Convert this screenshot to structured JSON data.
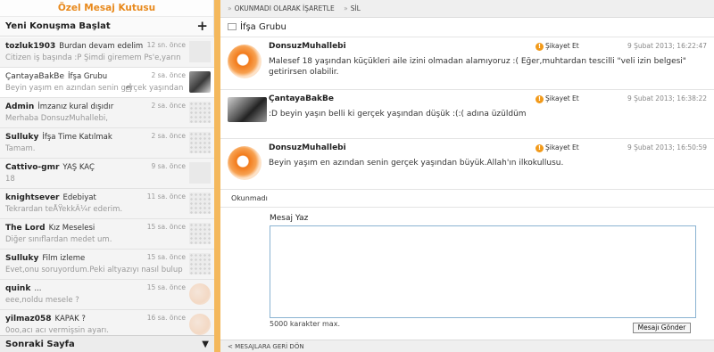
{
  "sidebar": {
    "title": "Özel Mesaj Kutusu",
    "new_conversation": "Yeni Konuşma Başlat",
    "plus": "+",
    "next_page": "Sonraki Sayfa",
    "next_chev": "▼",
    "items": [
      {
        "name": "tozluk1903",
        "subject": "Burdan devam edelim",
        "time": "12 sn. önce",
        "preview": "Citizen iş başında :P Şimdi giremem Ps'e,yarın",
        "thumb": "plain"
      },
      {
        "name": "ÇantayaBakBe",
        "subject": "İfşa Grubu",
        "time": "2 sa. önce",
        "preview": "Beyin yaşım en azından senin gerçek yaşından",
        "thumb": "photo"
      },
      {
        "name": "Admin",
        "subject": "İmzanız kural dışıdır",
        "time": "2 sa. önce",
        "preview": "Merhaba DonsuzMuhallebi,",
        "thumb": "grid"
      },
      {
        "name": "Sulluky",
        "subject": "İfşa Time Katılmak",
        "time": "2 sa. önce",
        "preview": "Tamam.",
        "thumb": "grid"
      },
      {
        "name": "Cattivo-gmr",
        "subject": "YAŞ KAÇ",
        "time": "9 sa. önce",
        "preview": "18",
        "thumb": "plain"
      },
      {
        "name": "knightsever",
        "subject": "Edebiyat",
        "time": "11 sa. önce",
        "preview": "Tekrardan teÅŸekkÃ¼r ederim.",
        "thumb": "grid"
      },
      {
        "name": "The Lord",
        "subject": "Kız Meselesi",
        "time": "15 sa. önce",
        "preview": "Diğer sınıflardan medet um.",
        "thumb": "grid"
      },
      {
        "name": "Sulluky",
        "subject": "Film izleme",
        "time": "15 sa. önce",
        "preview": "Evet,onu soruyordum.Peki altyazıyı nasıl bulup",
        "thumb": "grid"
      },
      {
        "name": "quink",
        "subject": "...",
        "time": "15 sa. önce",
        "preview": "eee,noldu mesele ?",
        "thumb": "logo"
      },
      {
        "name": "yilmaz058",
        "subject": "KAPAK ?",
        "time": "16 sa. önce",
        "preview": "0oo,acı acı vermişsin ayarı.",
        "thumb": "logo"
      }
    ]
  },
  "toolbar": {
    "mark_unread": "OKUNMADI OLARAK İŞARETLE",
    "delete": "SİL",
    "sep": "»"
  },
  "conversation": {
    "title": "İfşa Grubu",
    "report_label": "Şikayet Et",
    "status": "Okunmadı",
    "messages": [
      {
        "author": "DonsuzMuhallebi",
        "date": "9 Şubat 2013; 16:22:47",
        "text": "Malesef 18 yaşından küçükleri aile izini olmadan alamıyoruz :( Eğer,muhtardan tescilli \"veli izin belgesi\" getirirsen olabilir.",
        "avatar": "logo"
      },
      {
        "author": "ÇantayaBakBe",
        "date": "9 Şubat 2013; 16:38:22",
        "text": ":D beyin yaşın belli ki gerçek yaşından düşük :(:( adına üzüldüm",
        "avatar": "photo"
      },
      {
        "author": "DonsuzMuhallebi",
        "date": "9 Şubat 2013; 16:50:59",
        "text": "Beyin yaşım en azından senin gerçek yaşından büyük.Allah'ın ilkokullusu.",
        "avatar": "logo"
      }
    ]
  },
  "compose": {
    "label": "Mesaj Yaz",
    "value": "",
    "max_chars": "5000 karakter max.",
    "send": "Mesajı Gönder"
  },
  "footer": {
    "back": "< MESAJLARA GERİ DÖN"
  },
  "colors": {
    "accent": "#f4b85c",
    "title_orange": "#e8891c"
  }
}
